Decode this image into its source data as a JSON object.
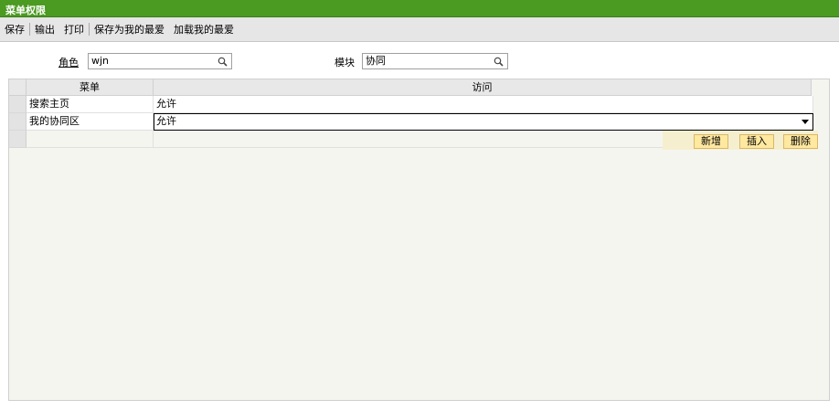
{
  "window": {
    "title": "菜单权限"
  },
  "toolbar": {
    "save": "保存",
    "export": "输出",
    "print": "打印",
    "save_favorite": "保存为我的最爱",
    "load_favorite": "加载我的最爱"
  },
  "filters": {
    "role_label": "角色",
    "role_value": "wjn",
    "module_label": "模块",
    "module_value": "协同"
  },
  "grid": {
    "columns": [
      "菜单",
      "访问"
    ],
    "rows": [
      {
        "menu": "搜索主页",
        "access": "允许"
      },
      {
        "menu": "我的协同区",
        "access": "允许"
      }
    ]
  },
  "actions": {
    "add": "新增",
    "insert": "插入",
    "delete": "删除"
  }
}
